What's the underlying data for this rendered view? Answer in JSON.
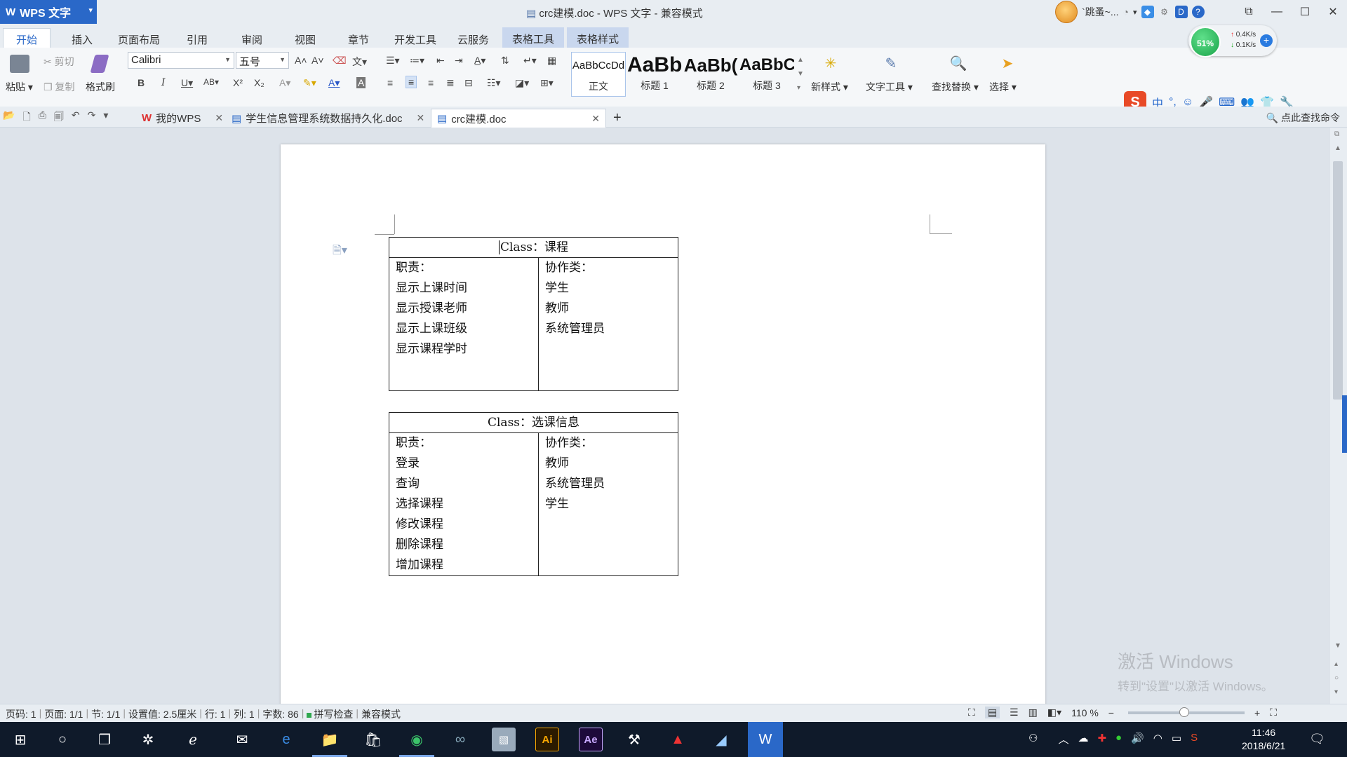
{
  "app": {
    "name": "WPS 文字",
    "window_title": "crc建模.doc - WPS 文字 - 兼容模式",
    "user": "`跳蚤~..."
  },
  "ribbon_tabs": [
    "开始",
    "插入",
    "页面布局",
    "引用",
    "审阅",
    "视图",
    "章节",
    "开发工具",
    "云服务",
    "表格工具",
    "表格样式"
  ],
  "ribbon": {
    "paste": "粘贴",
    "cut": "剪切",
    "copy": "复制",
    "format_painter": "格式刷",
    "font_name": "Calibri",
    "font_size": "五号",
    "styles": [
      {
        "sample": "AaBbCcDd",
        "name": "正文"
      },
      {
        "sample": "AaBb",
        "name": "标题 1"
      },
      {
        "sample": "AaBb(",
        "name": "标题 2"
      },
      {
        "sample": "AaBbC",
        "name": "标题 3"
      }
    ],
    "new_style": "新样式",
    "text_tools": "文字工具",
    "find_replace": "查找替换",
    "select": "选择"
  },
  "net_widget": {
    "percent": "51%",
    "up": "0.4K/s",
    "down": "0.1K/s"
  },
  "doc_tabs": [
    {
      "label": "我的WPS"
    },
    {
      "label": "学生信息管理系统数据持久化.doc"
    },
    {
      "label": "crc建模.doc"
    }
  ],
  "cmd_search": "点此查找命令",
  "document": {
    "tables": [
      {
        "header": "Class：课程",
        "responsibilities_label": "职责：",
        "collaborators_label": "协作类：",
        "responsibilities": [
          "显示上课时间",
          "显示授课老师",
          "显示上课班级",
          "显示课程学时"
        ],
        "collaborators": [
          "学生",
          "教师",
          "系统管理员"
        ]
      },
      {
        "header": "Class：选课信息",
        "responsibilities_label": "职责：",
        "collaborators_label": "协作类：",
        "responsibilities": [
          "登录",
          "查询",
          "选择课程",
          "修改课程",
          "删除课程",
          "增加课程"
        ],
        "collaborators": [
          "教师",
          "系统管理员",
          "学生"
        ]
      }
    ]
  },
  "watermark": {
    "line1": "激活 Windows",
    "line2": "转到\"设置\"以激活 Windows。"
  },
  "status": {
    "page_code": "页码: 1",
    "page": "页面: 1/1",
    "section": "节: 1/1",
    "setting": "设置值: 2.5厘米",
    "row": "行: 1",
    "col": "列: 1",
    "words": "字数: 86",
    "spell": "拼写检查",
    "compat": "兼容模式",
    "zoom": "110 %",
    "zoom_fraction": 0.48
  },
  "taskbar": {
    "time": "11:46",
    "date": "2018/6/21"
  }
}
